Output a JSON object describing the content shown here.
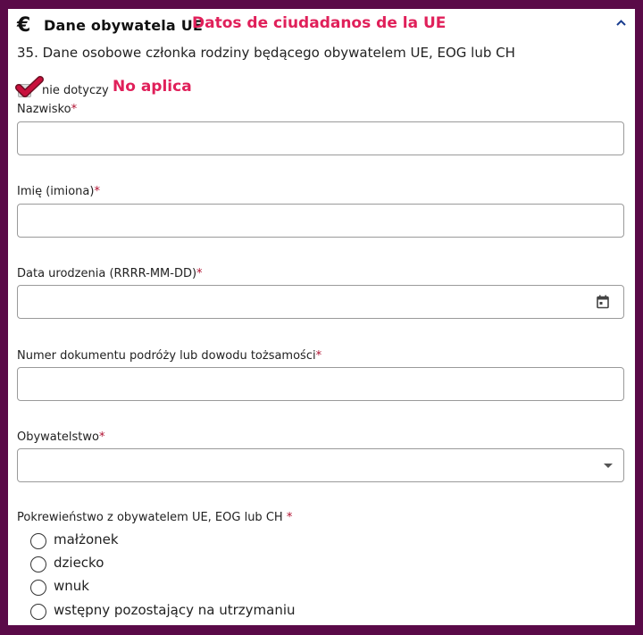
{
  "section": {
    "icon": "euro-icon",
    "icon_glyph": "€",
    "title": "Dane obywatela UE",
    "annotation_translation": "Datos de ciudadanos de la UE",
    "collapse_icon": "chevron-up-icon"
  },
  "question": "35. Dane osobowe członka rodziny będącego obywatelem UE, EOG lub CH",
  "not_applicable": {
    "label": "nie dotyczy",
    "checked": true,
    "annotation": "No aplica"
  },
  "fields": {
    "surname": {
      "label": "Nazwisko",
      "required_mark": "*",
      "value": ""
    },
    "given_names": {
      "label": "Imię (imiona)",
      "required_mark": "*",
      "value": ""
    },
    "birth_date": {
      "label": "Data urodzenia (RRRR-MM-DD)",
      "required_mark": "*",
      "value": "",
      "icon": "calendar-icon"
    },
    "document_number": {
      "label": "Numer dokumentu podróży lub dowodu tożsamości",
      "required_mark": "*",
      "value": ""
    },
    "citizenship": {
      "label": "Obywatelstwo",
      "required_mark": "*",
      "value": "",
      "icon": "dropdown-arrow-icon"
    }
  },
  "relationship": {
    "label": "Pokrewieństwo z obywatelem UE, EOG lub CH ",
    "required_mark": "*",
    "options": [
      "małżonek",
      "dziecko",
      "wnuk",
      "wstępny pozostający na utrzymaniu"
    ]
  },
  "colors": {
    "background": "#5a0a48",
    "annotation": "#e0205a",
    "required": "#b01030",
    "checkmark": "#c8103c",
    "chevron": "#1a3d8f"
  }
}
